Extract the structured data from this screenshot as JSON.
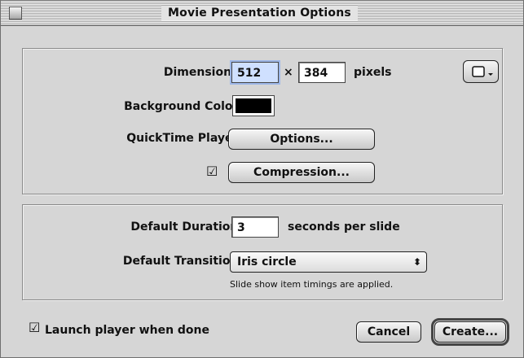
{
  "window": {
    "title": "Movie Presentation Options"
  },
  "group1": {
    "dimensions_label": "Dimensions:",
    "width_value": "512",
    "times": "×",
    "height_value": "384",
    "pixels_label": "pixels",
    "background_color_label": "Background Color:",
    "background_color": "#000000",
    "quicktime_label": "QuickTime Player:",
    "options_button": "Options...",
    "compression_checked": "☑",
    "compression_button": "Compression..."
  },
  "group2": {
    "duration_label": "Default Duration:",
    "duration_value": "3",
    "duration_units": "seconds per slide",
    "transition_label": "Default Transition:",
    "transition_value": "Iris circle",
    "transition_arrows": "⬍",
    "note": "Slide show item timings are applied."
  },
  "footer": {
    "launch_checked": "☑",
    "launch_label": "Launch player when done",
    "cancel_button": "Cancel",
    "create_button": "Create..."
  }
}
